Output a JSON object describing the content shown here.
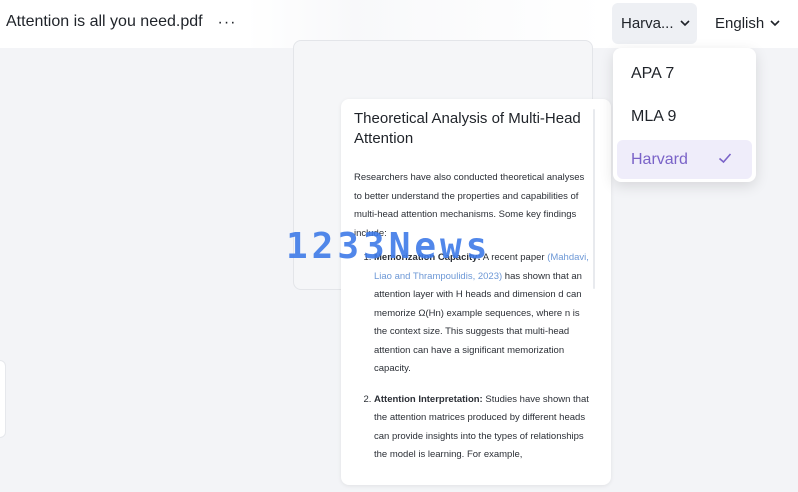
{
  "header": {
    "document_title": "Attention is all you need.pdf",
    "more_icon": "ellipsis-icon",
    "citation_style_label": "Harva...",
    "language_label": "English"
  },
  "dropdown": {
    "items": [
      {
        "label": "APA 7",
        "selected": false
      },
      {
        "label": "MLA 9",
        "selected": false
      },
      {
        "label": "Harvard",
        "selected": true
      }
    ],
    "accent_color": "#7a63c8"
  },
  "card": {
    "title": "Theoretical Analysis of Multi-Head Attention",
    "intro": "Researchers have also conducted theoretical analyses to better understand the properties and capabilities of multi-head attention mechanisms. Some key findings include:",
    "items": [
      {
        "heading": "Memorization Capacity:",
        "pre": " A recent paper ",
        "citation": "(Mahdavi, Liao and Thrampoulidis, 2023)",
        "post": " has shown that an attention layer with H heads and dimension d can memorize Ω(Hn) example sequences, where n is the context size. This suggests that multi-head attention can have a significant memorization capacity."
      },
      {
        "heading": "Attention Interpretation:",
        "pre": " Studies have shown that the attention matrices produced by different heads can provide insights into the types of relationships the model is learning. For example,",
        "citation": "",
        "post": ""
      }
    ]
  },
  "watermark": "1233News"
}
